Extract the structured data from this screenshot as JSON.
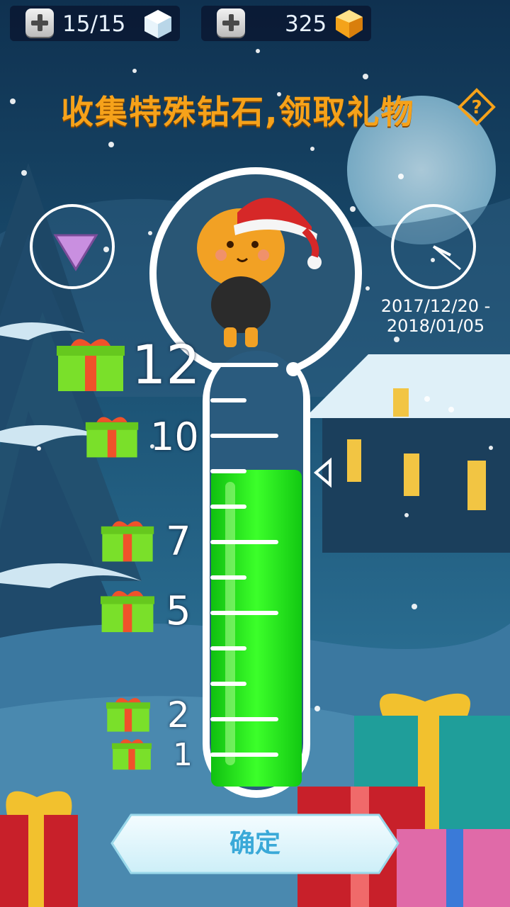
{
  "hud": {
    "lives": {
      "value": "15/15",
      "icon": "ice-cube-icon"
    },
    "gems": {
      "value": "325",
      "icon": "gold-gem-icon"
    }
  },
  "title": "收集特殊钻石,领取礼物",
  "event": {
    "date_line1": "2017/12/20 -",
    "date_line2": "2018/01/05",
    "special_gem_icon": "purple-triangle-gem-icon",
    "timer_icon": "clock-icon"
  },
  "progress": {
    "current": 9,
    "max": 12,
    "milestones": [
      "12",
      "10",
      "7",
      "5",
      "2",
      "1"
    ]
  },
  "confirm_label": "确定",
  "colors": {
    "title": "#f6a21a",
    "liquid": "#22e01a",
    "sky": "#1b4a6e",
    "button_text": "#3aa9d8"
  }
}
